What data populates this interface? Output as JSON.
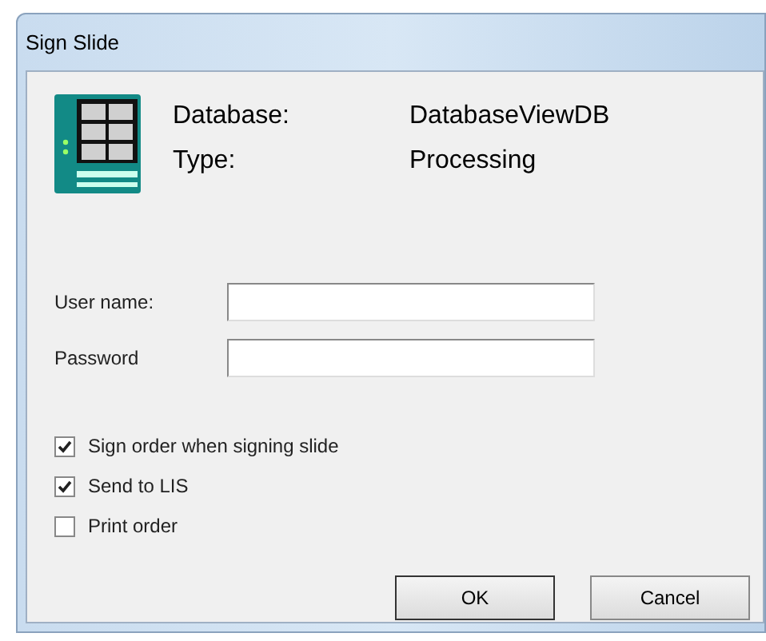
{
  "window": {
    "title": "Sign Slide"
  },
  "info": [
    {
      "label": "Database:",
      "value": "DatabaseViewDB"
    },
    {
      "label": "Type:",
      "value": "Processing"
    }
  ],
  "fields": [
    {
      "label": "User name:"
    },
    {
      "label": "Password"
    }
  ],
  "options": [
    {
      "label": "Sign order when signing slide",
      "checked": true
    },
    {
      "label": "Send to LIS",
      "checked": true
    },
    {
      "label": "Print order",
      "checked": false
    }
  ],
  "buttons": [
    "OK",
    "Cancel"
  ]
}
